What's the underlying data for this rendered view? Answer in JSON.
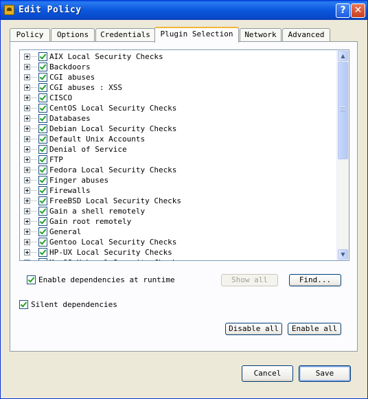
{
  "window": {
    "title": "Edit Policy"
  },
  "tabs": [
    "Policy",
    "Options",
    "Credentials",
    "Plugin Selection",
    "Network",
    "Advanced"
  ],
  "active_tab": "Plugin Selection",
  "plugins": [
    "AIX Local Security Checks",
    "Backdoors",
    "CGI abuses",
    "CGI abuses : XSS",
    "CISCO",
    "CentOS Local Security Checks",
    "Databases",
    "Debian Local Security Checks",
    "Default Unix Accounts",
    "Denial of Service",
    "FTP",
    "Fedora Local Security Checks",
    "Finger abuses",
    "Firewalls",
    "FreeBSD Local Security Checks",
    "Gain a shell remotely",
    "Gain root remotely",
    "General",
    "Gentoo Local Security Checks",
    "HP-UX Local Security Checks",
    "MacOS X Local Security Checks"
  ],
  "options": {
    "enable_dependencies": "Enable dependencies at runtime",
    "silent_dependencies": "Silent dependencies"
  },
  "buttons": {
    "show_all": "Show all",
    "find": "Find...",
    "disable_all": "Disable all",
    "enable_all": "Enable all",
    "cancel": "Cancel",
    "save": "Save"
  },
  "icons": {
    "app": "policy-app-icon",
    "help": "help-icon",
    "close": "close-icon",
    "expander": "tree-expand-icon",
    "check": "checkmark-icon"
  },
  "colors": {
    "titlebar": "#0a5fe4",
    "window_bg": "#ece9d8",
    "active_tab_accent": "#f6b43a",
    "checkmark": "#21a121"
  }
}
